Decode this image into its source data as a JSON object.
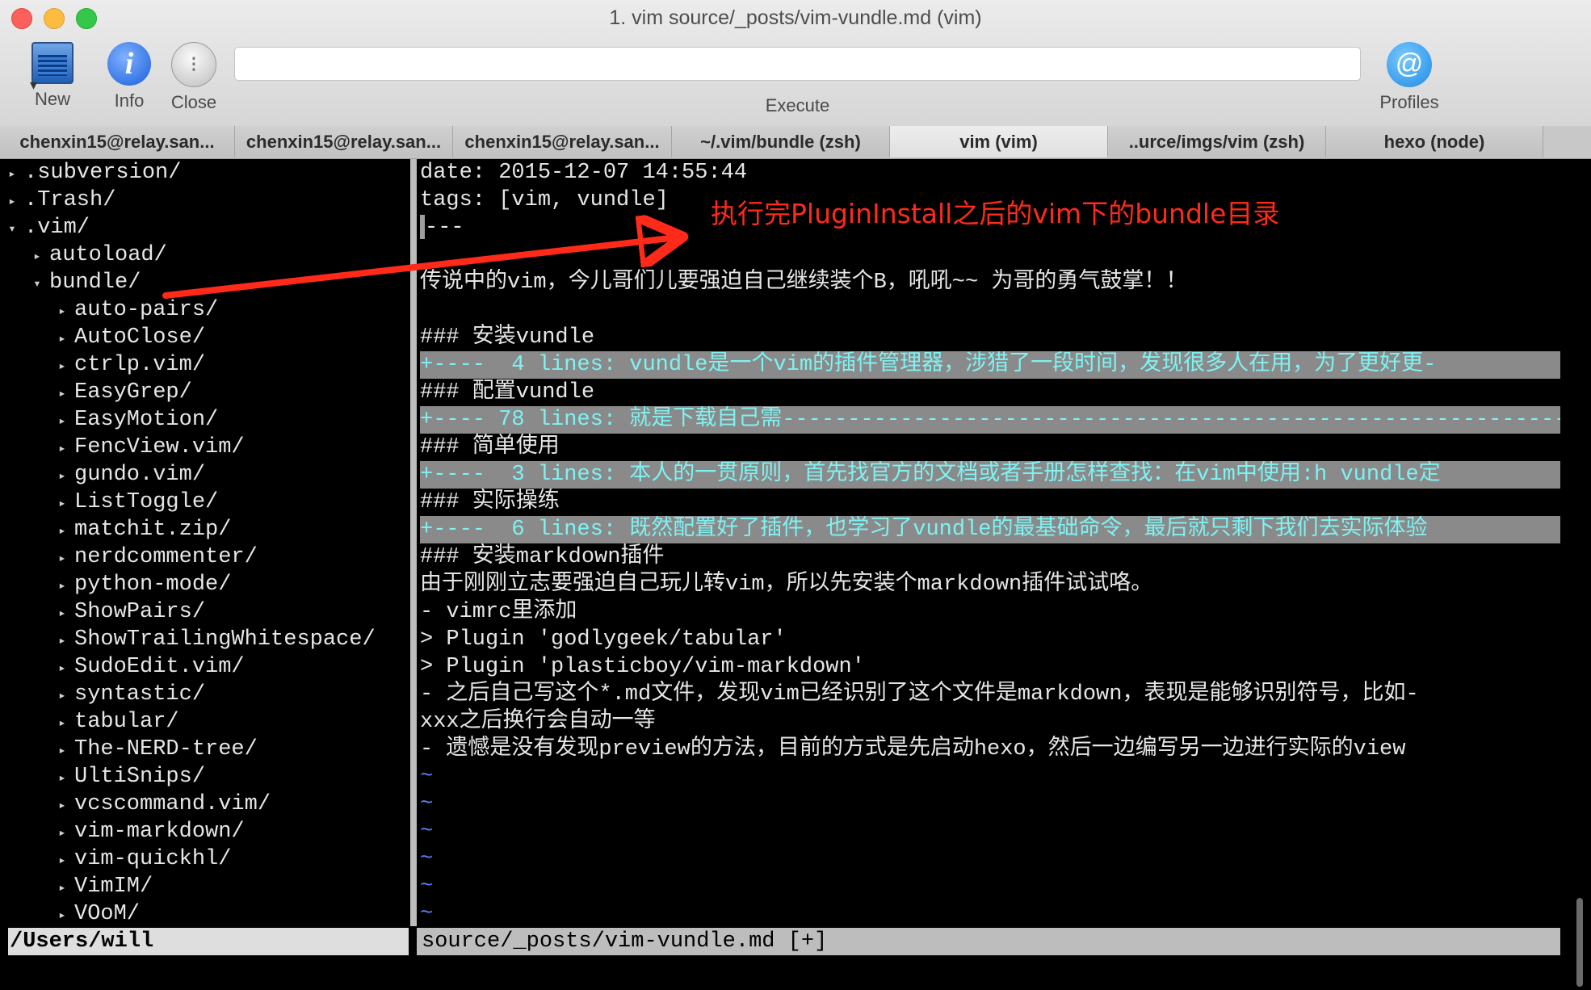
{
  "window": {
    "title": "1. vim source/_posts/vim-vundle.md (vim)"
  },
  "toolbar": {
    "new_label": "New",
    "info_label": "Info",
    "close_label": "Close",
    "execute_label": "Execute",
    "execute_value": "",
    "profiles_label": "Profiles"
  },
  "tabs": [
    {
      "label": "chenxin15@relay.san...",
      "active": false
    },
    {
      "label": "chenxin15@relay.san...",
      "active": false
    },
    {
      "label": "chenxin15@relay.san...",
      "active": false
    },
    {
      "label": "~/.vim/bundle (zsh)",
      "active": false
    },
    {
      "label": "vim (vim)",
      "active": true
    },
    {
      "label": "..urce/imgs/vim (zsh)",
      "active": false
    },
    {
      "label": "hexo (node)",
      "active": false
    }
  ],
  "tree": [
    {
      "indent": 0,
      "arrow": "▸",
      "name": ".subversion/"
    },
    {
      "indent": 0,
      "arrow": "▸",
      "name": ".Trash/"
    },
    {
      "indent": 0,
      "arrow": "▾",
      "name": ".vim/"
    },
    {
      "indent": 1,
      "arrow": "▸",
      "name": "autoload/"
    },
    {
      "indent": 1,
      "arrow": "▾",
      "name": "bundle/"
    },
    {
      "indent": 2,
      "arrow": "▸",
      "name": "auto-pairs/"
    },
    {
      "indent": 2,
      "arrow": "▸",
      "name": "AutoClose/"
    },
    {
      "indent": 2,
      "arrow": "▸",
      "name": "ctrlp.vim/"
    },
    {
      "indent": 2,
      "arrow": "▸",
      "name": "EasyGrep/"
    },
    {
      "indent": 2,
      "arrow": "▸",
      "name": "EasyMotion/"
    },
    {
      "indent": 2,
      "arrow": "▸",
      "name": "FencView.vim/"
    },
    {
      "indent": 2,
      "arrow": "▸",
      "name": "gundo.vim/"
    },
    {
      "indent": 2,
      "arrow": "▸",
      "name": "ListToggle/"
    },
    {
      "indent": 2,
      "arrow": "▸",
      "name": "matchit.zip/"
    },
    {
      "indent": 2,
      "arrow": "▸",
      "name": "nerdcommenter/"
    },
    {
      "indent": 2,
      "arrow": "▸",
      "name": "python-mode/"
    },
    {
      "indent": 2,
      "arrow": "▸",
      "name": "ShowPairs/"
    },
    {
      "indent": 2,
      "arrow": "▸",
      "name": "ShowTrailingWhitespace/"
    },
    {
      "indent": 2,
      "arrow": "▸",
      "name": "SudoEdit.vim/"
    },
    {
      "indent": 2,
      "arrow": "▸",
      "name": "syntastic/"
    },
    {
      "indent": 2,
      "arrow": "▸",
      "name": "tabular/"
    },
    {
      "indent": 2,
      "arrow": "▸",
      "name": "The-NERD-tree/"
    },
    {
      "indent": 2,
      "arrow": "▸",
      "name": "UltiSnips/"
    },
    {
      "indent": 2,
      "arrow": "▸",
      "name": "vcscommand.vim/"
    },
    {
      "indent": 2,
      "arrow": "▸",
      "name": "vim-markdown/"
    },
    {
      "indent": 2,
      "arrow": "▸",
      "name": "vim-quickhl/"
    },
    {
      "indent": 2,
      "arrow": "▸",
      "name": "VimIM/"
    },
    {
      "indent": 2,
      "arrow": "▸",
      "name": "VOoM/"
    }
  ],
  "editor_lines": [
    {
      "kind": "text",
      "text": "date: 2015-12-07 14:55:44"
    },
    {
      "kind": "text",
      "text": "tags: [vim, vundle]"
    },
    {
      "kind": "text",
      "text": "---"
    },
    {
      "kind": "text",
      "text": ""
    },
    {
      "kind": "text",
      "text": "传说中的vim，今儿哥们儿要强迫自己继续装个B，吼吼~~ 为哥的勇气鼓掌！！"
    },
    {
      "kind": "text",
      "text": ""
    },
    {
      "kind": "text",
      "text": "### 安装vundle"
    },
    {
      "kind": "fold",
      "text": "+----  4 lines: vundle是一个vim的插件管理器，涉猎了一段时间，发现很多人在用，为了更好更-"
    },
    {
      "kind": "text",
      "text": "### 配置vundle"
    },
    {
      "kind": "fold",
      "text": "+---- 78 lines: 就是下载自己需-------------------------------------------------------------"
    },
    {
      "kind": "text",
      "text": "### 简单使用"
    },
    {
      "kind": "fold",
      "text": "+----  3 lines: 本人的一贯原则，首先找官方的文档或者手册怎样查找：在vim中使用:h vundle定"
    },
    {
      "kind": "text",
      "text": "### 实际操练"
    },
    {
      "kind": "fold",
      "text": "+----  6 lines: 既然配置好了插件，也学习了vundle的最基础命令，最后就只剩下我们去实际体验"
    },
    {
      "kind": "text",
      "text": "### 安装markdown插件"
    },
    {
      "kind": "text",
      "text": "由于刚刚立志要强迫自己玩儿转vim，所以先安装个markdown插件试试咯。"
    },
    {
      "kind": "text",
      "text": "- vimrc里添加"
    },
    {
      "kind": "text",
      "text": "> Plugin 'godlygeek/tabular'"
    },
    {
      "kind": "text",
      "text": "> Plugin 'plasticboy/vim-markdown'"
    },
    {
      "kind": "text",
      "text": "- 之后自己写这个*.md文件，发现vim已经识别了这个文件是markdown，表现是能够识别符号，比如-"
    },
    {
      "kind": "text",
      "text": "xxx之后换行会自动一等"
    },
    {
      "kind": "text",
      "text": "- 遗憾是没有发现preview的方法，目前的方式是先启动hexo，然后一边编写另一边进行实际的view"
    },
    {
      "kind": "tilde",
      "text": "~"
    },
    {
      "kind": "tilde",
      "text": "~"
    },
    {
      "kind": "tilde",
      "text": "~"
    },
    {
      "kind": "tilde",
      "text": "~"
    },
    {
      "kind": "tilde",
      "text": "~"
    },
    {
      "kind": "tilde",
      "text": "~"
    }
  ],
  "statusline": {
    "left": "/Users/will",
    "right": "source/_posts/vim-vundle.md [+]"
  },
  "annotation": {
    "text": "执行完PluginInstall之后的vim下的bundle目录"
  },
  "colors": {
    "fold_bg": "#8a8a8a",
    "fold_fg": "#7ef2f2",
    "tilde": "#5b7cf1",
    "annotation": "#ff2a1a"
  }
}
